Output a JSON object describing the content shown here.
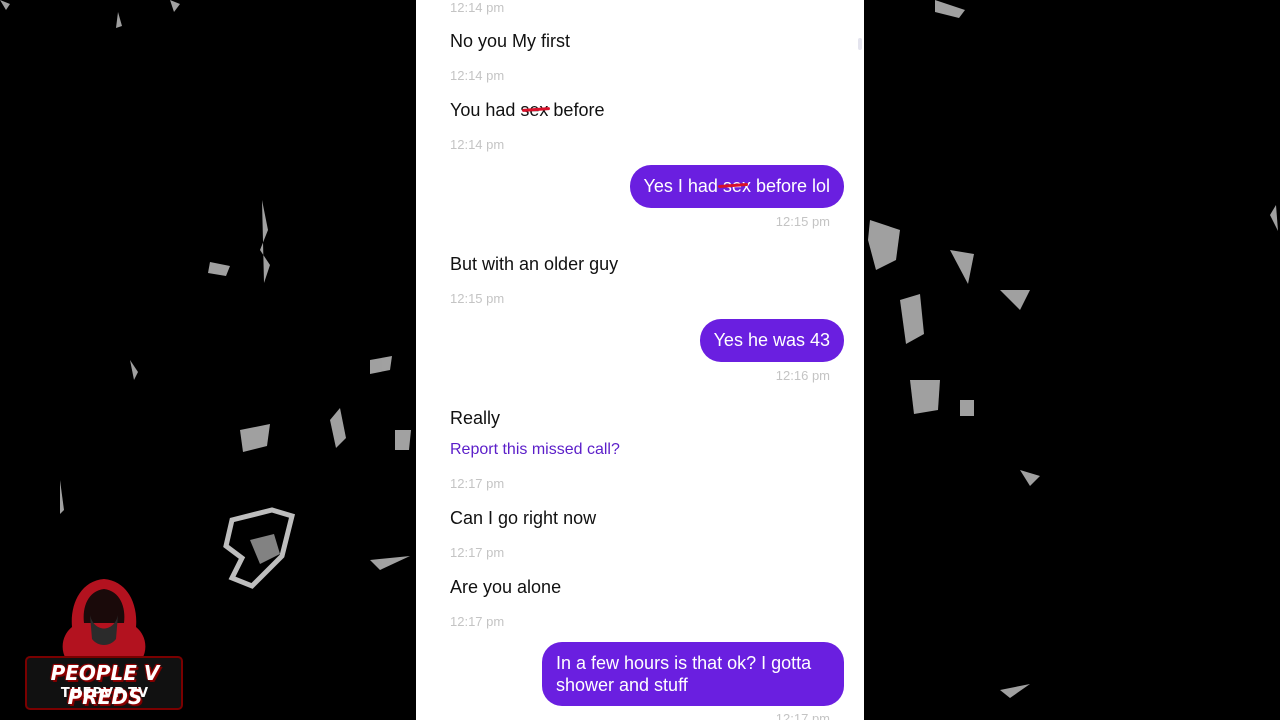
{
  "messages": [
    {
      "side": "in",
      "text": "No you My first",
      "timestamp_before": "12:14 pm"
    },
    {
      "side": "in",
      "text": "You had sex before",
      "timestamp_before": "12:14 pm"
    },
    {
      "side": "out",
      "text": "Yes I had sex before lol",
      "timestamp_before": "12:14 pm"
    },
    {
      "side": "in",
      "text": "But with an older guy",
      "timestamp_before": "12:15 pm"
    },
    {
      "side": "out",
      "text": "Yes he was 43",
      "timestamp_before": "12:15 pm"
    },
    {
      "side": "in",
      "text": "Really",
      "timestamp_before": "12:16 pm"
    },
    {
      "side": "in",
      "text": "Can I go right now",
      "timestamp_before": "12:17 pm"
    },
    {
      "side": "in",
      "text": "Are you alone",
      "timestamp_before": "12:17 pm"
    },
    {
      "side": "out",
      "text": "In a few hours is that ok? I gotta shower and stuff",
      "timestamp_before": "12:17 pm"
    }
  ],
  "timestamps": [
    "12:14 pm",
    "12:14 pm",
    "12:14 pm",
    "12:15 pm",
    "12:15 pm",
    "12:16 pm",
    "12:17 pm",
    "12:17 pm",
    "12:17 pm",
    "12:17 pm"
  ],
  "report_link": "Report this missed call?",
  "logo": {
    "line1": "PEOPLE V PREDS",
    "line2": "THEPVP.TV"
  },
  "colors": {
    "outgoing_bubble": "#6a1fe0",
    "link": "#5b1ec9",
    "timestamp": "#c4c4c4",
    "redaction": "#d8112a"
  }
}
